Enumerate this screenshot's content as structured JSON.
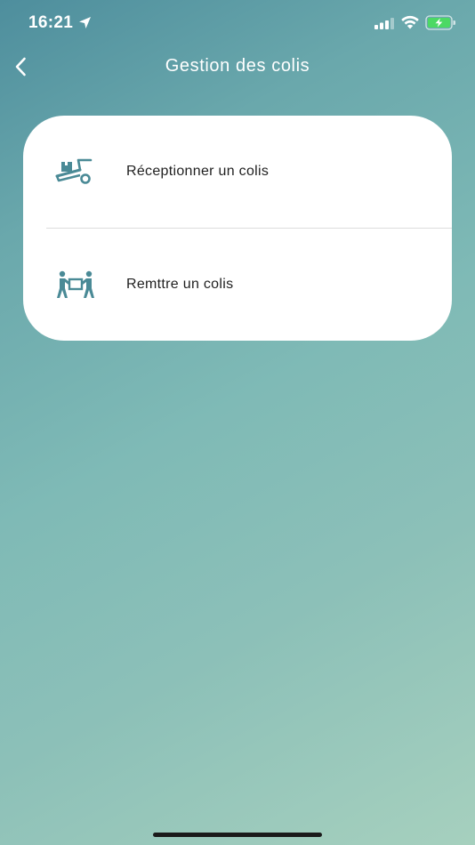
{
  "status_bar": {
    "time": "16:21",
    "location_icon": "location-arrow-icon",
    "signal_icon": "cellular-signal-icon",
    "wifi_icon": "wifi-icon",
    "battery_icon": "battery-charging-icon"
  },
  "header": {
    "title": "Gestion des colis",
    "back_icon": "chevron-left-icon"
  },
  "menu": {
    "items": [
      {
        "label": "Réceptionner un colis",
        "icon": "hand-truck-icon"
      },
      {
        "label": "Remttre un colis",
        "icon": "people-handover-icon"
      }
    ]
  },
  "colors": {
    "gradient_start": "#4e8e9d",
    "gradient_end": "#a6d0be",
    "icon_color": "#4a8a96",
    "card_background": "#ffffff",
    "text_primary": "#1f1f1f",
    "battery_green": "#4cd964"
  }
}
